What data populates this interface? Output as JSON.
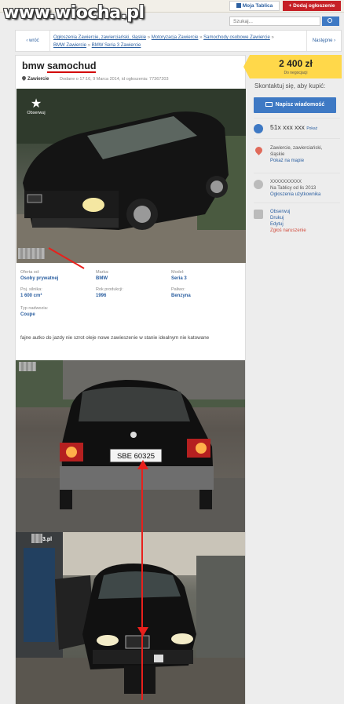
{
  "watermark": "www.wiocha.pl",
  "header": {
    "my_account": "Moja Tablica",
    "add_listing": "+ Dodaj ogłoszenie",
    "search_placeholder": "Szukaj..."
  },
  "breadcrumb": {
    "back": "wróć",
    "items": [
      "Ogłoszenia Zawiercie, zawierciański, śląskie",
      "Motoryzacja Zawiercie",
      "Samochody osobowe Zawiercie",
      "BMW Zawiercie",
      "BMW Seria 3 Zawiercie"
    ],
    "next": "Następne"
  },
  "listing": {
    "title_part1": "bmw ",
    "title_part2": "samochud",
    "location": "Zawiercie",
    "added": "Dodane o 17:16, 9 Marca 2014, id ogłoszenia: 77367203",
    "follow": "Obserwuj",
    "params": [
      {
        "label": "Oferta od:",
        "value": "Osoby prywatnej"
      },
      {
        "label": "Marka:",
        "value": "BMW"
      },
      {
        "label": "Model:",
        "value": "Seria 3"
      },
      {
        "label": "Poj. silnika:",
        "value": "1 600 cm³"
      },
      {
        "label": "Rok produkcji:",
        "value": "1996"
      },
      {
        "label": "Paliwo:",
        "value": "Benzyna"
      },
      {
        "label": "Typ nadwozia:",
        "value": "Coupe"
      }
    ],
    "description": "fajne autko do jazdy nie szrot oleje nowe zawieszenie w stanie idealnym nie katowane",
    "plate": "SBE 60325",
    "photo3_tag": "3.pl"
  },
  "sidebar": {
    "price": "2 400 zł",
    "negotiable": "Do negocjacji",
    "contact_heading": "Skontaktuj się, aby kupić:",
    "message_button": "Napisz wiadomość",
    "phone": "51x xxx xxx",
    "phone_show": "Pokaż",
    "address": "Zawiercie, zawierciański, śląskie",
    "map_link": "Pokaż na mapie",
    "user_name": "XXXXXXXXXX",
    "user_since": "Na Tablicy od lis 2013",
    "user_ads": "Ogłoszenia użytkownika",
    "actions": [
      "Obserwuj",
      "Drukuj",
      "Edytuj",
      "Zgłoś naruszenie"
    ]
  },
  "colors": {
    "accent_blue": "#3e79c4",
    "price_yellow": "#ffd84a",
    "add_red": "#c62026",
    "annotation_red": "#e8201c"
  }
}
